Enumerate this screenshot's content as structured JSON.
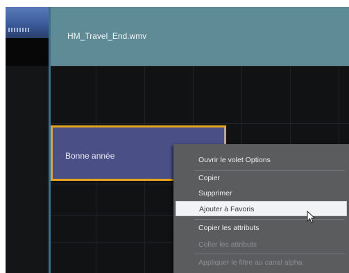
{
  "video_track": {
    "clip_name": "HM_Travel_End.wmv"
  },
  "title_track": {
    "clip_name": "Bonne année"
  },
  "context_menu": {
    "items": [
      {
        "label": "Ouvrir le volet Options",
        "enabled": true
      },
      {
        "label": "Copier",
        "enabled": true
      },
      {
        "label": "Supprimer",
        "enabled": true
      },
      {
        "label": "Ajouter à Favoris",
        "enabled": true,
        "highlighted": true
      },
      {
        "label": "Copier les attributs",
        "enabled": true
      },
      {
        "label": "Coller les attributs",
        "enabled": false
      },
      {
        "label": "Appliquer le filtre au canal alpha",
        "enabled": false
      }
    ]
  },
  "colors": {
    "selection_border": "#e5a51e",
    "title_clip_fill": "#4a4f86",
    "video_clip_fill": "#5f8b96",
    "menu_bg": "#5a5c5e"
  },
  "icons": [
    "video-thumbnail",
    "mouse-pointer-icon"
  ]
}
